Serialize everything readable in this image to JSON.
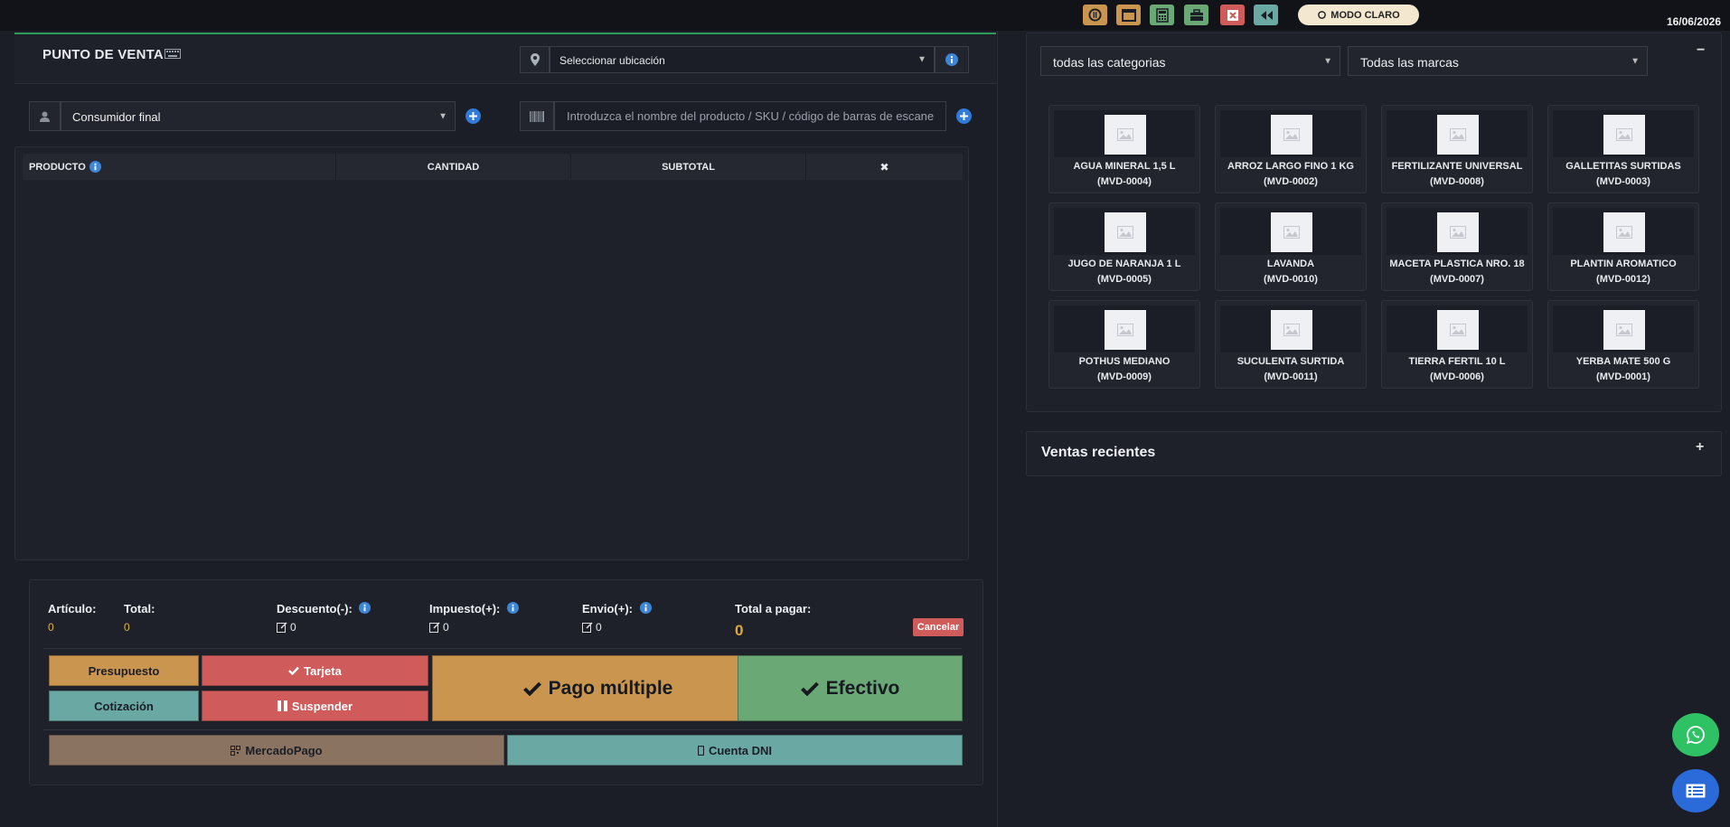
{
  "topbar": {
    "icons": [
      "power-icon",
      "window-icon",
      "calculator-icon",
      "briefcase-icon",
      "close-window-icon",
      "rewind-icon"
    ],
    "mode_label": "MODO CLARO",
    "date": "16/06/2026"
  },
  "pos": {
    "title": "PUNTO DE VENTA",
    "location_placeholder": "Seleccionar ubicación",
    "customer": "Consumidor final",
    "product_search_placeholder": "Introduzca el nombre del producto / SKU / código de barras de escaneo"
  },
  "table": {
    "headers": [
      "PRODUCTO",
      "CANTIDAD",
      "SUBTOTAL",
      "✖"
    ]
  },
  "totals": {
    "articulo_label": "Artículo:",
    "articulo_value": "0",
    "total_label": "Total:",
    "total_value": "0",
    "descuento_label": "Descuento(-):",
    "descuento_value": "0",
    "impuesto_label": "Impuesto(+):",
    "impuesto_value": "0",
    "envio_label": "Envio(+):",
    "envio_value": "0",
    "total_pagar_label": "Total a pagar:",
    "total_pagar_value": "0",
    "cancel_label": "Cancelar"
  },
  "buttons": {
    "presupuesto": "Presupuesto",
    "cotizacion": "Cotización",
    "tarjeta": "Tarjeta",
    "suspender": "Suspender",
    "pago_multiple": "Pago múltiple",
    "efectivo": "Efectivo",
    "mercadopago": "MercadoPago",
    "cuenta_dni": "Cuenta DNI"
  },
  "filters": {
    "category": "todas las categorias",
    "brand": "Todas las marcas"
  },
  "products": [
    {
      "name": "AGUA MINERAL 1,5 L",
      "sku": "(MVD-0004)"
    },
    {
      "name": "ARROZ LARGO FINO 1 KG",
      "sku": "(MVD-0002)"
    },
    {
      "name": "FERTILIZANTE UNIVERSAL",
      "sku": "(MVD-0008)"
    },
    {
      "name": "GALLETITAS SURTIDAS",
      "sku": "(MVD-0003)"
    },
    {
      "name": "JUGO DE NARANJA 1 L",
      "sku": "(MVD-0005)"
    },
    {
      "name": "LAVANDA",
      "sku": "(MVD-0010)"
    },
    {
      "name": "MACETA PLASTICA NRO. 18",
      "sku": "(MVD-0007)"
    },
    {
      "name": "PLANTIN AROMATICO",
      "sku": "(MVD-0012)"
    },
    {
      "name": "POTHUS MEDIANO",
      "sku": "(MVD-0009)"
    },
    {
      "name": "SUCULENTA SURTIDA",
      "sku": "(MVD-0011)"
    },
    {
      "name": "TIERRA FERTIL 10 L",
      "sku": "(MVD-0006)"
    },
    {
      "name": "YERBA MATE 500 G",
      "sku": "(MVD-0001)"
    }
  ],
  "recent": {
    "title": "Ventas recientes"
  },
  "colors": {
    "accent_blue": "#2f7bd9",
    "orange": "#c9954f",
    "red": "#cf5b5b",
    "teal": "#6aa8a4",
    "green": "#6aa876",
    "brown": "#8a7360",
    "whatsapp": "#2ec264",
    "chat": "#2a6ad9"
  }
}
